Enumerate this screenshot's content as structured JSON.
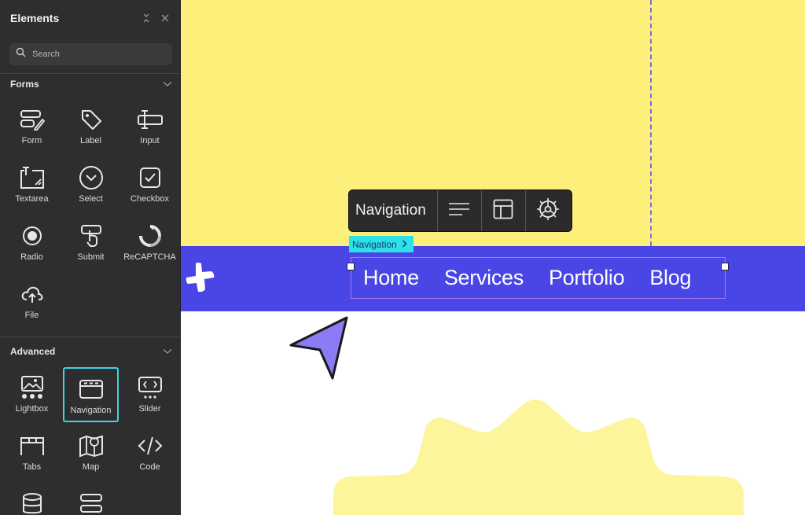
{
  "sidebar": {
    "title": "Elements",
    "search_placeholder": "Search",
    "sections": {
      "forms": {
        "label": "Forms",
        "items": [
          "Form",
          "Label",
          "Input",
          "Textarea",
          "Select",
          "Checkbox",
          "Radio",
          "Submit",
          "ReCAPTCHA",
          "File"
        ]
      },
      "advanced": {
        "label": "Advanced",
        "items": [
          "Lightbox",
          "Navigation",
          "Slider",
          "Tabs",
          "Map",
          "Code"
        ]
      }
    }
  },
  "canvas": {
    "toolbar_label": "Navigation",
    "selection_tag": "Navigation",
    "nav_links": [
      "Home",
      "Services",
      "Portfolio",
      "Blog"
    ]
  },
  "colors": {
    "sidebar_bg": "#2e2e2e",
    "canvas_yellow": "#fdf07a",
    "navbar_blue": "#4a46e6",
    "selection_accent": "#2ee0ea",
    "cursor_purple": "#8b7cf6",
    "badge_yellow": "#fdf59c"
  }
}
